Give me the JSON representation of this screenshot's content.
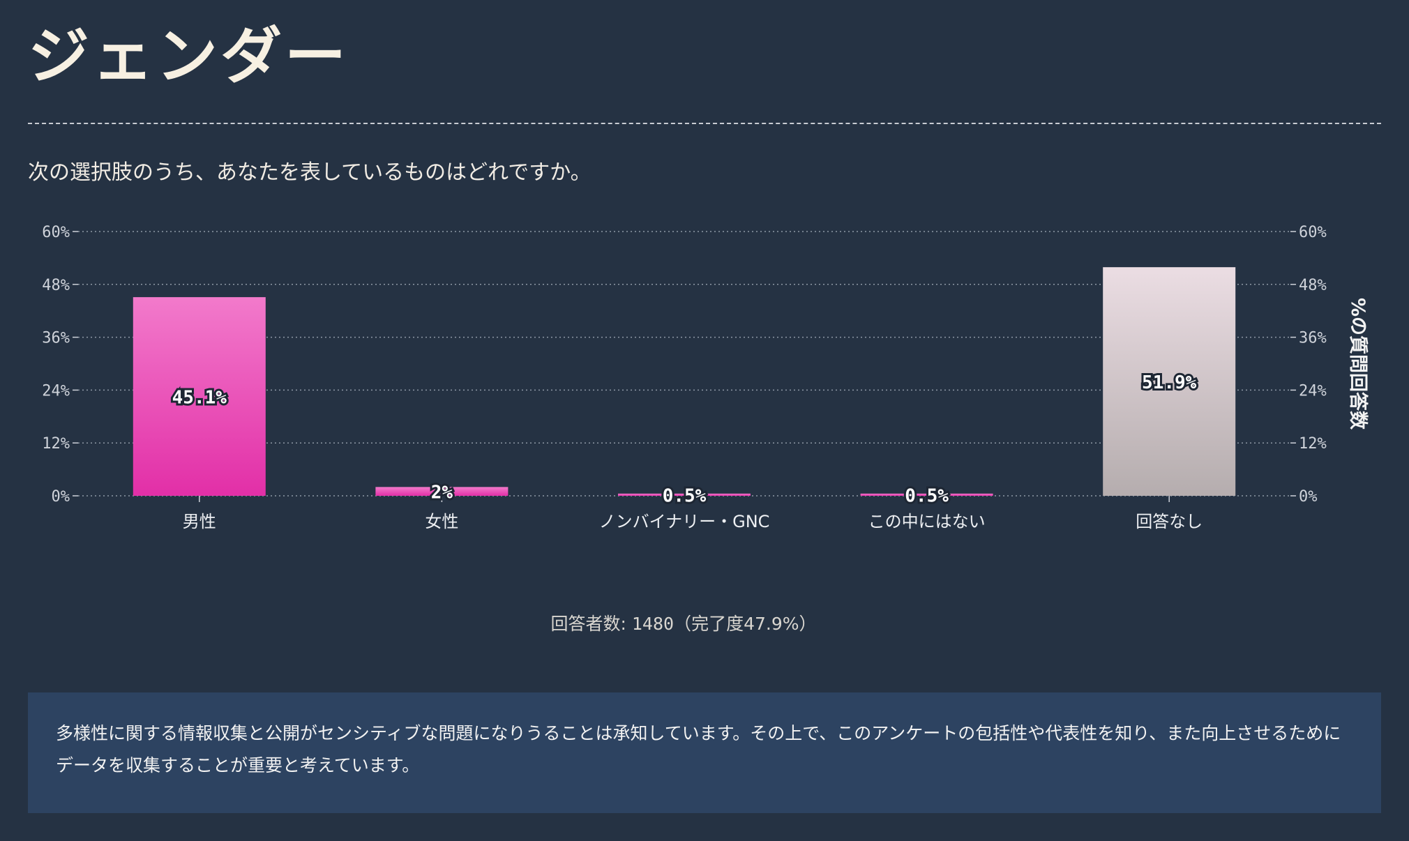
{
  "page": {
    "title": "ジェンダー",
    "question": "次の選択肢のうち、あなたを表しているものはどれですか。",
    "respondents_label": "回答者数:",
    "respondents_count": "1480",
    "completion": "（完了度47.9%）",
    "note": "多様性に関する情報収集と公開がセンシティブな問題になりうることは承知しています。その上で、このアンケートの包括性や代表性を知り、また向上させるためにデータを収集することが重要と考えています。"
  },
  "colors": {
    "background": "#253243",
    "bar_primary_top": "#f27acb",
    "bar_primary_bottom": "#e22fa7",
    "bar_none_top": "#ebdde3",
    "bar_none_bottom": "#b5adae",
    "note_background": "#2d4361"
  },
  "chart_data": {
    "type": "bar",
    "categories": [
      "男性",
      "女性",
      "ノンバイナリー・GNC",
      "この中にはない",
      "回答なし"
    ],
    "values": [
      45.1,
      2,
      0.5,
      0.5,
      51.9
    ],
    "value_labels": [
      "45.1%",
      "2%",
      "0.5%",
      "0.5%",
      "51.9%"
    ],
    "ylabel_right": "%の質問回答数",
    "yticks": [
      "0%",
      "12%",
      "24%",
      "36%",
      "48%",
      "60%"
    ],
    "ylim": [
      0,
      60
    ],
    "grid": true,
    "dual_y_axis": true
  }
}
